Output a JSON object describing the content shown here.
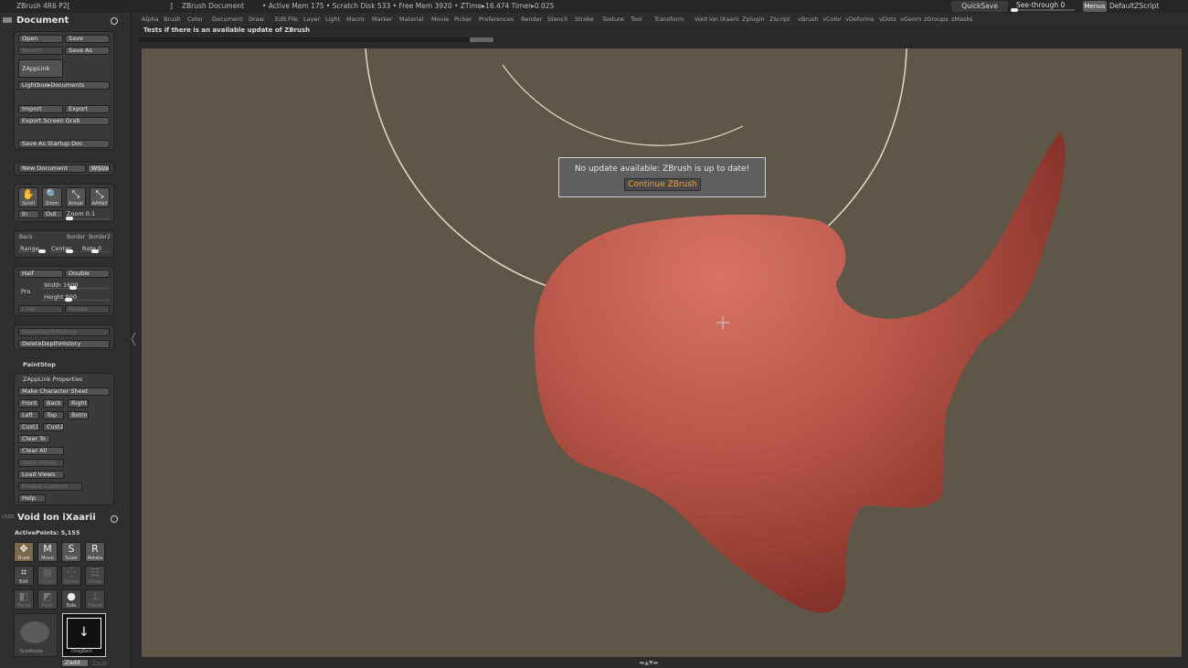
{
  "titlebar": {
    "app": "ZBrush 4R6 P2[",
    "bracket": "]",
    "doc": "ZBrush Document",
    "stats": "• Active Mem 175  • Scratch Disk 533  • Free Mem 3920  • ZTime▸16.474 Timer▸0.025",
    "quicksave": "QuickSave",
    "see_through": "See-through  0",
    "menus": "Menus",
    "default_script": "DefaultZScript"
  },
  "menubar": [
    "Alpha",
    "Brush",
    "Color",
    "Document",
    "Draw",
    "Edit",
    "File",
    "Layer",
    "Light",
    "Macro",
    "Marker",
    "Material",
    "Movie",
    "Picker",
    "Preferences",
    "Render",
    "Stencil",
    "Stroke",
    "Texture",
    "Tool",
    "Transform",
    "Void Ion iXaarii",
    "Zplugin",
    "Zscript",
    "vBrush",
    "vColor",
    "vDeforms",
    "vDots",
    "vGeom",
    "zGroups",
    "zMasks"
  ],
  "update_tip": "Tests if there is an available update of ZBrush",
  "document": {
    "title": "Document",
    "open": "Open",
    "save": "Save",
    "revert": "Revert",
    "save_as": "Save As",
    "zapplink": "ZAppLink",
    "lightbox": "Lightbox▸Documents",
    "import": "Import",
    "export": "Export",
    "export_grab": "Export Screen Grab",
    "save_startup": "Save As Startup Doc",
    "new_doc": "New Document",
    "wsize": "WSize",
    "scroll": "Scroll",
    "zoom": "Zoom",
    "actual": "Actual",
    "aahalf": "AAHalf",
    "in": "In",
    "out": "Out",
    "zoom_val": "Zoom 0.1",
    "back": "Back",
    "border": "Border",
    "border2": "Border2",
    "range": "Range",
    "center": "Center",
    "rate": "Rate 0",
    "half": "Half",
    "double": "Double",
    "pro": "Pro",
    "width": "Width 1600",
    "height": "Height 900",
    "crop": "Crop",
    "resize": "Resize",
    "store_depth": "StoreDepthHistory",
    "delete_depth": "DeleteDepthHistory",
    "paintstop": "PaintStop",
    "zapplink_props": "ZAppLink Properties",
    "make_sheet": "Make Character Sheet",
    "front": "Front",
    "back2": "Back",
    "right": "Right",
    "left": "Left",
    "top": "Top",
    "botm": "Botm",
    "cust1": "Cust1",
    "cust2": "Cust2",
    "clear_to": "Clear To",
    "clear_all": "Clear All",
    "save_views": "Save Views",
    "load_views": "Load Views",
    "enable_custom": "Enable Custom",
    "help": "Help"
  },
  "tool": {
    "user": "USER",
    "title": "Void Ion iXaarii",
    "active_points": "ActivePoints: 5,155",
    "draw": "Draw",
    "move": "Move",
    "scale": "Scale",
    "rotate": "Rotate",
    "edit": "Edit",
    "scolor": "SColor",
    "gizmo": "Gizmo",
    "ssnap": "SSnap",
    "persp": "Persp",
    "floor": "Floor",
    "solo": "Solo",
    "transp": "Transp",
    "sub1": "Subdivide",
    "sub2": "DragRect",
    "zadd": "Zadd",
    "zsub": "Zsub"
  },
  "dialog": {
    "message": "No update available: ZBrush is up to date!",
    "button": "Continue ZBrush"
  },
  "colors": {
    "canvas_bg": "#5e5748",
    "model": "#b9564a",
    "accent": "#f0a030"
  }
}
